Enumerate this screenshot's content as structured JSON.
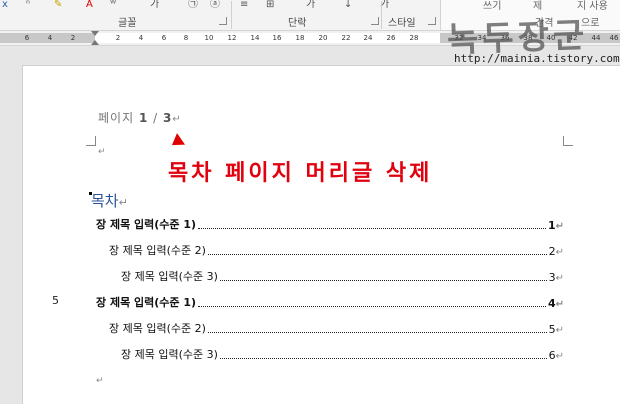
{
  "ribbon": {
    "groups": [
      "글꼴",
      "단락",
      "스타일"
    ],
    "styles_partial": [
      "쓰기",
      "제",
      "지 사용",
      "간격",
      "으로"
    ],
    "accent_red": "#e00000"
  },
  "ruler": {
    "marks": [
      "6",
      "4",
      "2",
      "2",
      "4",
      "6",
      "8",
      "10",
      "12",
      "14",
      "16",
      "18",
      "20",
      "22",
      "24",
      "26",
      "28",
      "32",
      "34",
      "36",
      "38",
      "40",
      "42",
      "44",
      "46"
    ]
  },
  "page": {
    "header_label": "페이지",
    "page_current": "1",
    "page_sep": "/",
    "page_total": "3",
    "pilcrow": "↵",
    "annotation": "목차 페이지 머리글 삭제",
    "toc_heading": "목차",
    "line_number": "5",
    "toc": [
      {
        "text": "장 제목 입력(수준 1)",
        "page": "1",
        "level": 1
      },
      {
        "text": "장 제목 입력(수준 2)",
        "page": "2",
        "level": 2
      },
      {
        "text": "장 제목 입력(수준 3)",
        "page": "3",
        "level": 3
      },
      {
        "text": "장 제목 입력(수준 1)",
        "page": "4",
        "level": 1
      },
      {
        "text": "장 제목 입력(수준 2)",
        "page": "5",
        "level": 2
      },
      {
        "text": "장 제목 입력(수준 3)",
        "page": "6",
        "level": 3
      }
    ]
  },
  "watermark": {
    "title": "녹두장군",
    "url": "http://mainia.tistory.com"
  }
}
